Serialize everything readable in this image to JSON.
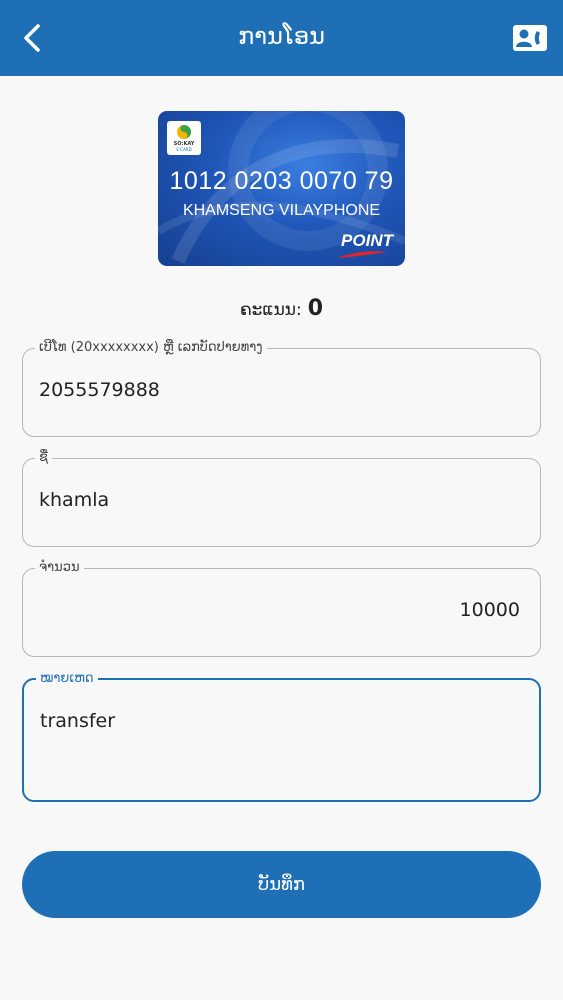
{
  "header": {
    "title": "ການໂອນ",
    "back_icon": "chevron-left-icon",
    "contact_icon": "contact-card-icon"
  },
  "card": {
    "logo_text": "SO:KAY",
    "logo_sub": "E-CARD",
    "number": "1012 0203 0070 79",
    "holder": "KHAMSENG VILAYPHONE",
    "brand": "POINT"
  },
  "points": {
    "label": "ຄະແນນ:",
    "value": "0"
  },
  "form": {
    "phone": {
      "label": "ເບີໂທ (20xxxxxxxx) ຫຼື ເລກບັດປາຍທາງ",
      "value": "2055579888"
    },
    "name": {
      "label": "ຊື່",
      "value": "khamla"
    },
    "amount": {
      "label": "ຈຳນວນ",
      "value": "10000"
    },
    "note": {
      "label": "ໝາຍເຫດ",
      "value": "transfer"
    }
  },
  "save_label": "ບັນທຶກ",
  "colors": {
    "primary": "#1f6fb6",
    "background": "#f8f8f8",
    "border": "#b7b7b7"
  }
}
